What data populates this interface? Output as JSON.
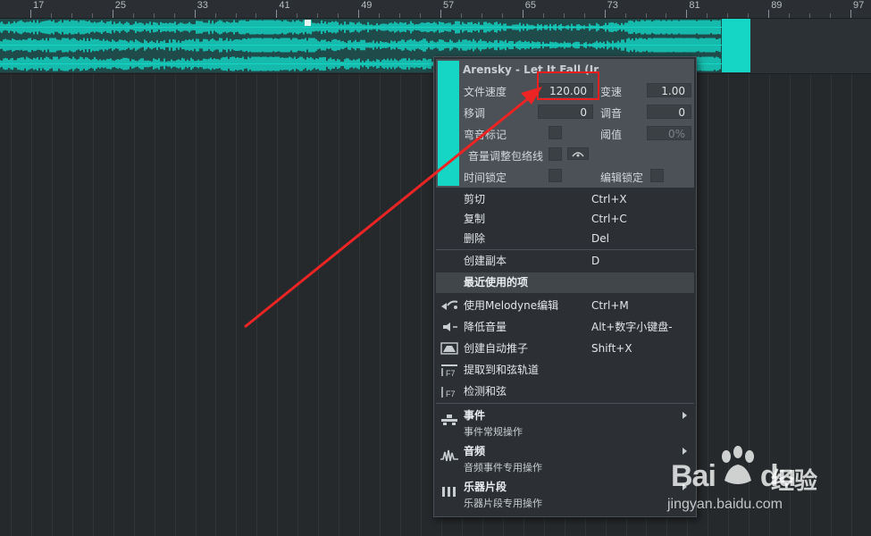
{
  "ruler": {
    "bars": [
      "17",
      "25",
      "33",
      "41",
      "49",
      "57",
      "65",
      "73",
      "81",
      "89",
      "97"
    ]
  },
  "clip": {
    "color": "#15d6c4"
  },
  "inspector": {
    "title": "Arensky - Let It Fall (Ir",
    "file_tempo_label": "文件速度",
    "file_tempo_value": "120.00",
    "speed_label": "变速",
    "speed_value": "1.00",
    "transpose_label": "移调",
    "transpose_value": "0",
    "tune_label": "调音",
    "tune_value": "0",
    "bend_marker_label": "弯音标记",
    "threshold_label": "阈值",
    "threshold_value": "0%",
    "envelope_label": "音量调整包络线",
    "time_lock_label": "时间锁定",
    "edit_lock_label": "编辑锁定"
  },
  "menu": {
    "cut": {
      "label": "剪切",
      "shortcut": "Ctrl+X"
    },
    "copy": {
      "label": "复制",
      "shortcut": "Ctrl+C"
    },
    "delete": {
      "label": "删除",
      "shortcut": "Del"
    },
    "duplicate": {
      "label": "创建副本",
      "shortcut": "D"
    },
    "recent_header": "最近使用的项",
    "melodyne": {
      "label": "使用Melodyne编辑",
      "shortcut": "Ctrl+M",
      "icon": "melodyne-icon"
    },
    "lower_volume": {
      "label": "降低音量",
      "shortcut": "Alt+数字小键盘-",
      "icon": "speaker-icon"
    },
    "automation": {
      "label": "创建自动推子",
      "shortcut": "Shift+X",
      "icon": "fader-icon"
    },
    "extract_chords": {
      "label": "提取到和弦轨道",
      "icon": "chord-extract-icon",
      "key": "F7"
    },
    "detect_chords": {
      "label": "检测和弦",
      "icon": "chord-detect-icon",
      "key": "F7"
    },
    "submenus": [
      {
        "title": "事件",
        "desc": "事件常规操作",
        "icon": "event-icon"
      },
      {
        "title": "音频",
        "desc": "音频事件专用操作",
        "icon": "audio-icon"
      },
      {
        "title": "乐器片段",
        "desc": "乐器片段专用操作",
        "icon": "instrument-icon"
      }
    ]
  },
  "watermark": {
    "brand": "Bai",
    "brand_tail": "du",
    "text": "经验",
    "url": "jingyan.baidu.com"
  }
}
